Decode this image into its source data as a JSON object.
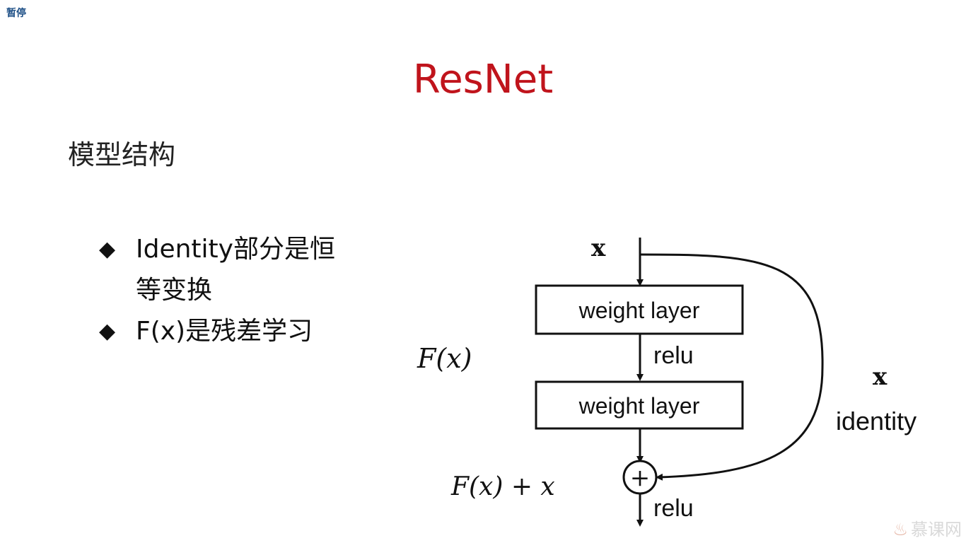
{
  "overlay": {
    "pause_label": "暂停"
  },
  "slide": {
    "title": "ResNet",
    "section_title": "模型结构",
    "bullets": [
      {
        "mark": "◆",
        "text": "Identity部分是恒等变换"
      },
      {
        "mark": "◆",
        "text": "F(x)是残差学习"
      }
    ]
  },
  "diagram": {
    "input_label": "x",
    "block1_label": "weight layer",
    "relu1_label": "relu",
    "block2_label": "weight layer",
    "relu2_label": "relu",
    "fx_label": "F(x)",
    "sum_label": "F(x) + x",
    "shortcut_x_label": "x",
    "shortcut_identity_label": "identity",
    "plus_symbol": "+"
  },
  "watermark": {
    "text": "慕课网"
  },
  "colors": {
    "title": "#c0141c",
    "text": "#111111"
  }
}
